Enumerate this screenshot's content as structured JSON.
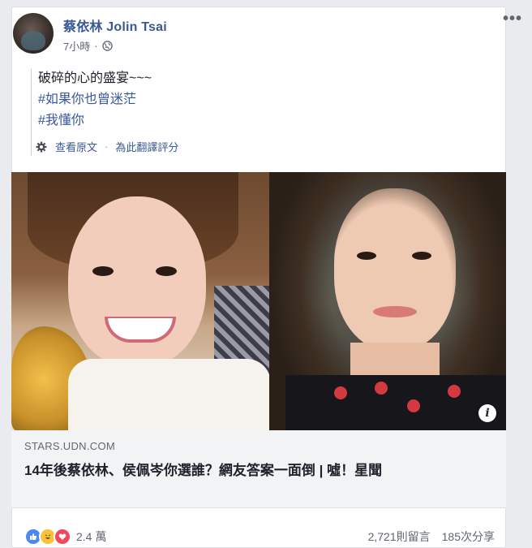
{
  "post": {
    "author": "蔡依林 Jolin Tsai",
    "time": "7小時",
    "more_label": "•••",
    "lines": [
      "破碎的心的盛宴~~~",
      "#如果你也曾迷茫",
      "#我懂你"
    ],
    "translate": {
      "see_original": "查看原文",
      "separator": "·",
      "rate_translation": "為此翻譯評分"
    }
  },
  "link_preview": {
    "domain": "STARS.UDN.COM",
    "headline": "14年後蔡依林、侯佩岑你選誰？網友答案一面倒 | 噓！星聞",
    "info_label": "i"
  },
  "footer": {
    "reaction_count": "2.4 萬",
    "comments": "2,721則留言",
    "shares": "185次分享"
  },
  "icons": {
    "globe": "globe-icon",
    "gear": "gear-icon",
    "like": "like-icon",
    "haha": "haha-icon",
    "love": "love-icon"
  },
  "colors": {
    "link_blue": "#385898",
    "text": "#1d2129",
    "meta_gray": "#606770"
  }
}
